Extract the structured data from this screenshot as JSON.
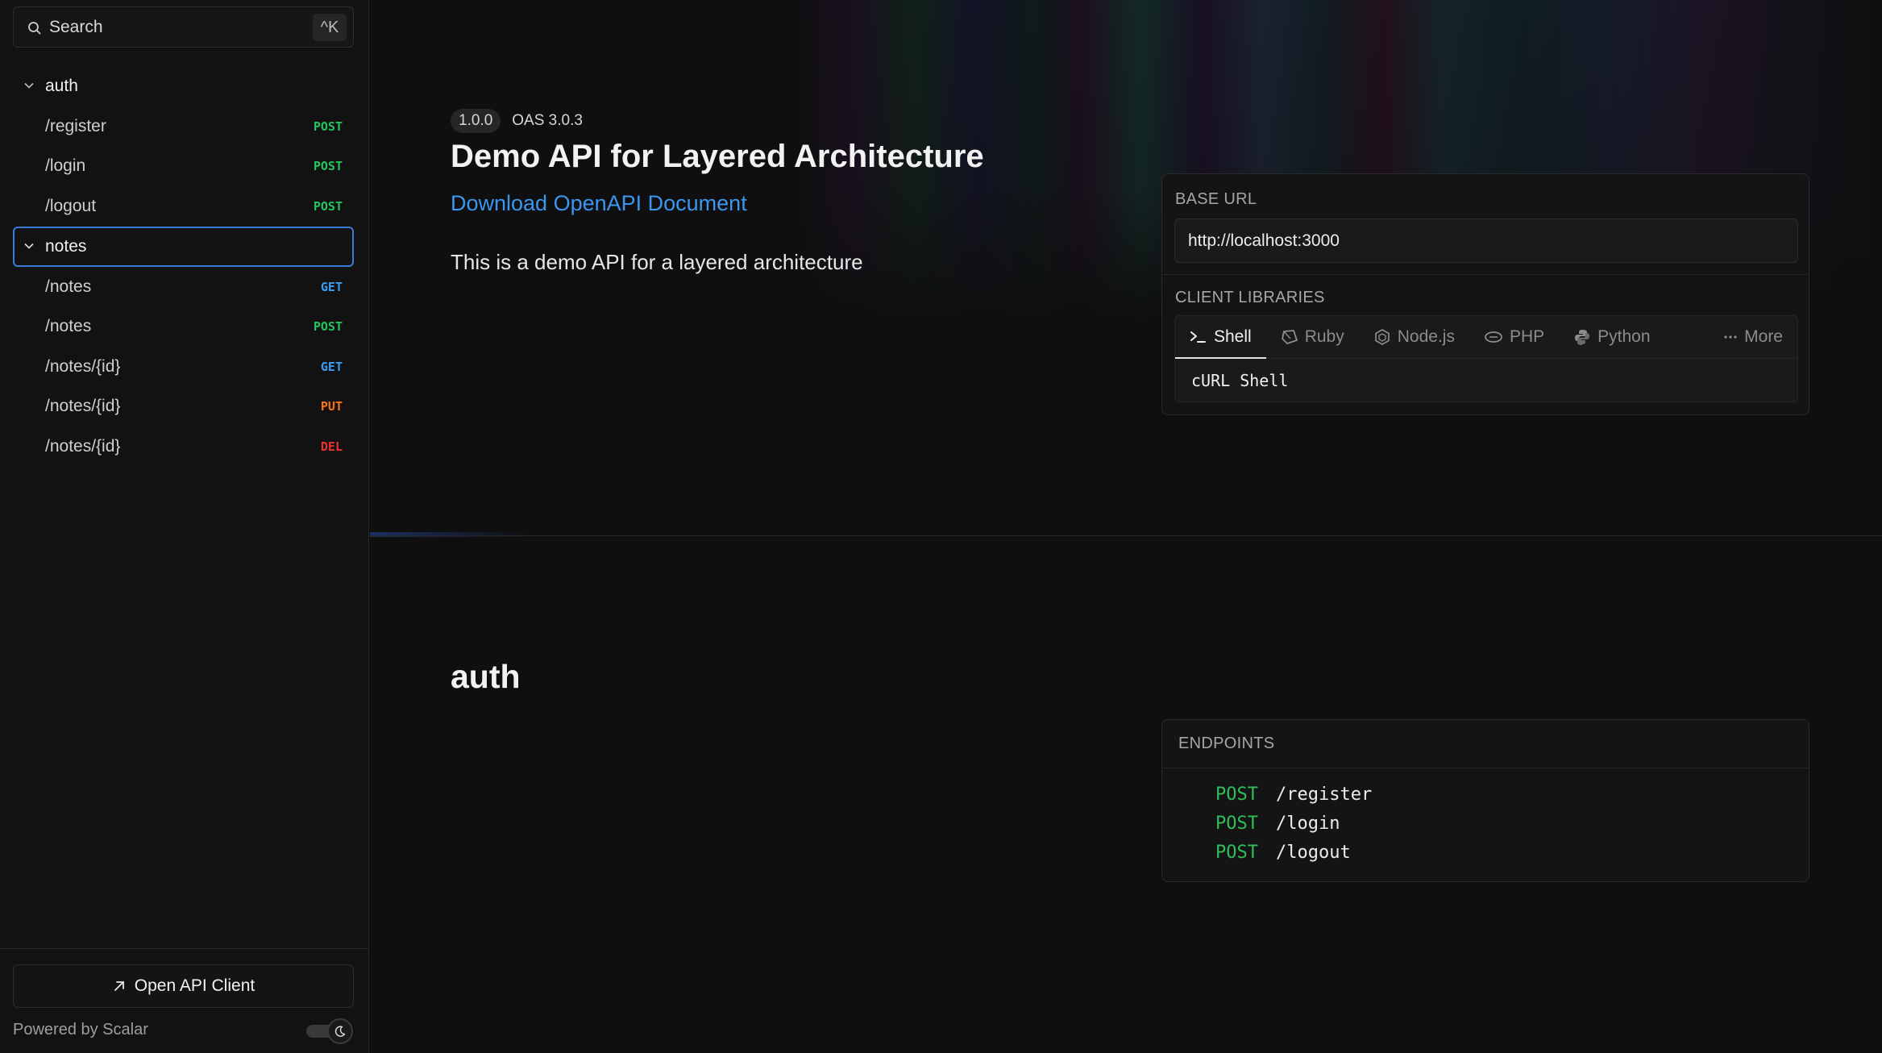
{
  "colors": {
    "post": "#22c55e",
    "get": "#3b9cf6",
    "put": "#f97316",
    "del": "#ef2f2f",
    "link": "#3b96f0",
    "active_border": "#3a7bd5"
  },
  "search": {
    "label": "Search",
    "shortcut": "^K",
    "icon": "search-icon"
  },
  "sidebar": {
    "groups": [
      {
        "label": "auth",
        "items": [
          {
            "path": "/register",
            "method": "POST"
          },
          {
            "path": "/login",
            "method": "POST"
          },
          {
            "path": "/logout",
            "method": "POST"
          }
        ]
      },
      {
        "label": "notes",
        "items": [
          {
            "path": "/notes",
            "method": "GET"
          },
          {
            "path": "/notes",
            "method": "POST"
          },
          {
            "path": "/notes/{id}",
            "method": "GET"
          },
          {
            "path": "/notes/{id}",
            "method": "PUT"
          },
          {
            "path": "/notes/{id}",
            "method": "DEL"
          }
        ]
      }
    ],
    "footer": {
      "open_client": "Open API Client",
      "powered_by": "Powered by Scalar"
    }
  },
  "main": {
    "version": "1.0.0",
    "oas": "OAS 3.0.3",
    "title": "Demo API for Layered Architecture",
    "download": "Download OpenAPI Document",
    "description": "This is a demo API for a layered architecture",
    "base_url_label": "BASE URL",
    "base_url": "http://localhost:3000",
    "client_libraries_label": "CLIENT LIBRARIES",
    "client_tabs": [
      {
        "label": "Shell",
        "icon": "terminal-icon"
      },
      {
        "label": "Ruby",
        "icon": "ruby-icon"
      },
      {
        "label": "Node.js",
        "icon": "nodejs-icon"
      },
      {
        "label": "PHP",
        "icon": "php-icon"
      },
      {
        "label": "Python",
        "icon": "python-icon"
      },
      {
        "label": "More",
        "icon": "more-icon"
      }
    ],
    "client_selected": "cURL Shell",
    "section_title": "auth",
    "endpoints_label": "ENDPOINTS",
    "endpoints": [
      {
        "method": "POST",
        "path": "/register"
      },
      {
        "method": "POST",
        "path": "/login"
      },
      {
        "method": "POST",
        "path": "/logout"
      }
    ]
  }
}
